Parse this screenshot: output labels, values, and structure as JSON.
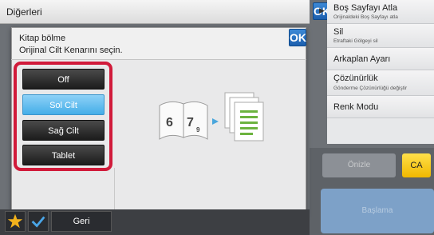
{
  "header": {
    "title": "Diğerleri",
    "ok_label": "OK"
  },
  "right_panel": {
    "items": [
      {
        "label": "Boş Sayfayı Atla",
        "sub": "Orijinaldeki Boş Sayfayı atla"
      },
      {
        "label": "Sil",
        "sub": "Etraftaki Gölgeyi sil"
      },
      {
        "label": "Arkaplan Ayarı",
        "sub": ""
      },
      {
        "label": "Çözünürlük",
        "sub": "Gönderme Çözünürlüğü değiştir"
      },
      {
        "label": "Renk Modu",
        "sub": ""
      }
    ],
    "preview_label": "Önizle",
    "ca_label": "CA",
    "start_label": "Başlama"
  },
  "dialog": {
    "title": "Kitap bölme",
    "subtitle": "Orijinal Cilt Kenarını seçin.",
    "ok_label": "OK",
    "options": [
      {
        "label": "Off",
        "selected": false
      },
      {
        "label": "Sol Cilt",
        "selected": true
      },
      {
        "label": "Sağ Cilt",
        "selected": false
      },
      {
        "label": "Tablet",
        "selected": false
      }
    ],
    "illustration": {
      "page_left": "6",
      "page_right": "7",
      "page_sub": "9"
    }
  },
  "footer": {
    "back_label": "Geri"
  },
  "colors": {
    "accent_blue": "#2a74c4",
    "highlight_red": "#d11a3a",
    "selected_option": "#55b5ec",
    "ca_yellow": "#f6c800"
  }
}
